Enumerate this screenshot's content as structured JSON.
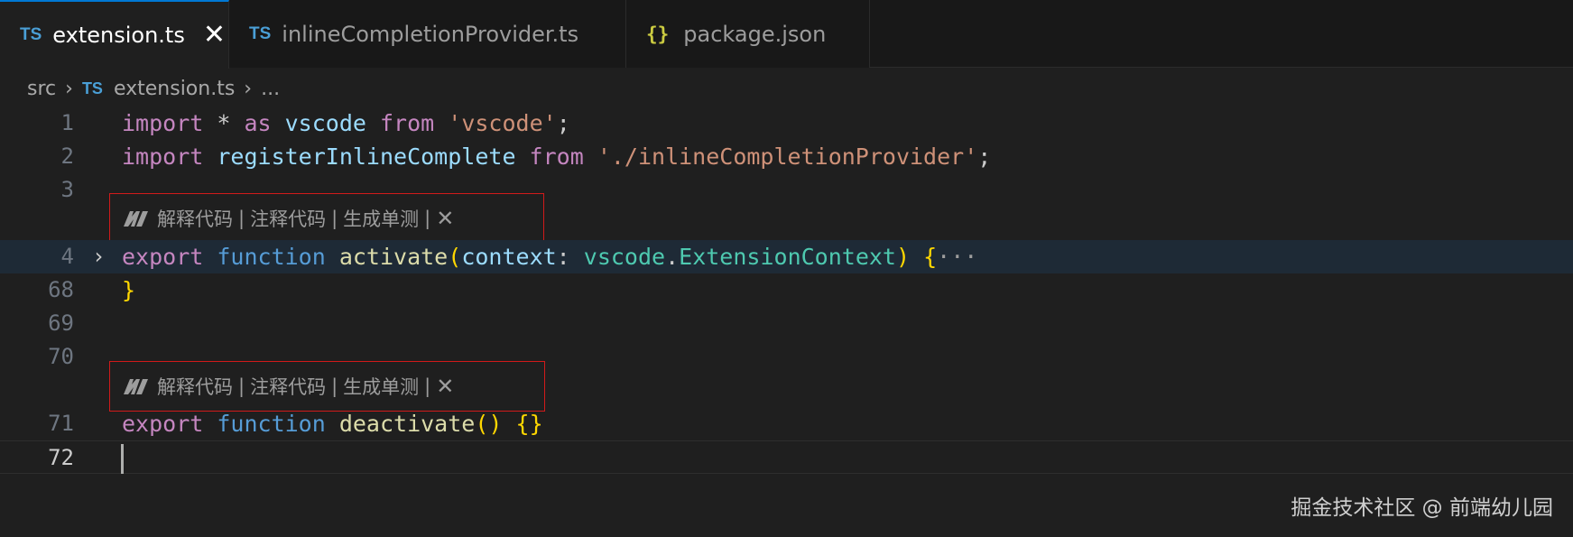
{
  "tabs": [
    {
      "icon": "TS",
      "label": "extension.ts",
      "active": true,
      "close": "✕"
    },
    {
      "icon": "TS",
      "label": "inlineCompletionProvider.ts",
      "active": false
    },
    {
      "icon": "{}",
      "label": "package.json",
      "active": false
    }
  ],
  "breadcrumb": {
    "folder": "src",
    "file_icon": "TS",
    "file": "extension.ts",
    "more": "..."
  },
  "codelens": {
    "items": [
      "解释代码",
      "注释代码",
      "生成单测"
    ],
    "separator": "|",
    "close": "✕"
  },
  "lines": [
    {
      "num": "1"
    },
    {
      "num": "2"
    },
    {
      "num": "3"
    },
    {
      "num": "4"
    },
    {
      "num": "68"
    },
    {
      "num": "69"
    },
    {
      "num": "70"
    },
    {
      "num": "71"
    },
    {
      "num": "72"
    }
  ],
  "code": {
    "l1": {
      "import": "import",
      "star": " * ",
      "as": "as",
      "vscode": " vscode ",
      "from": "from",
      "str": " 'vscode'",
      "semi": ";"
    },
    "l2": {
      "import": "import",
      "name": " registerInlineComplete ",
      "from": "from",
      "str": " './inlineCompletionProvider'",
      "semi": ";"
    },
    "l4": {
      "export": "export",
      "function": " function ",
      "fn": "activate",
      "open": "(",
      "param": "context",
      "colon": ": ",
      "ns": "vscode",
      "dot": ".",
      "type": "ExtensionContext",
      "close": ")",
      "space": " ",
      "brace": "{",
      "ellipsis": "···"
    },
    "l68": {
      "brace": "}"
    },
    "l71": {
      "export": "export",
      "function": " function ",
      "fn": "deactivate",
      "parens": "()",
      "space": " ",
      "braces": "{}"
    }
  },
  "watermark": "掘金技术社区 @ 前端幼儿园"
}
